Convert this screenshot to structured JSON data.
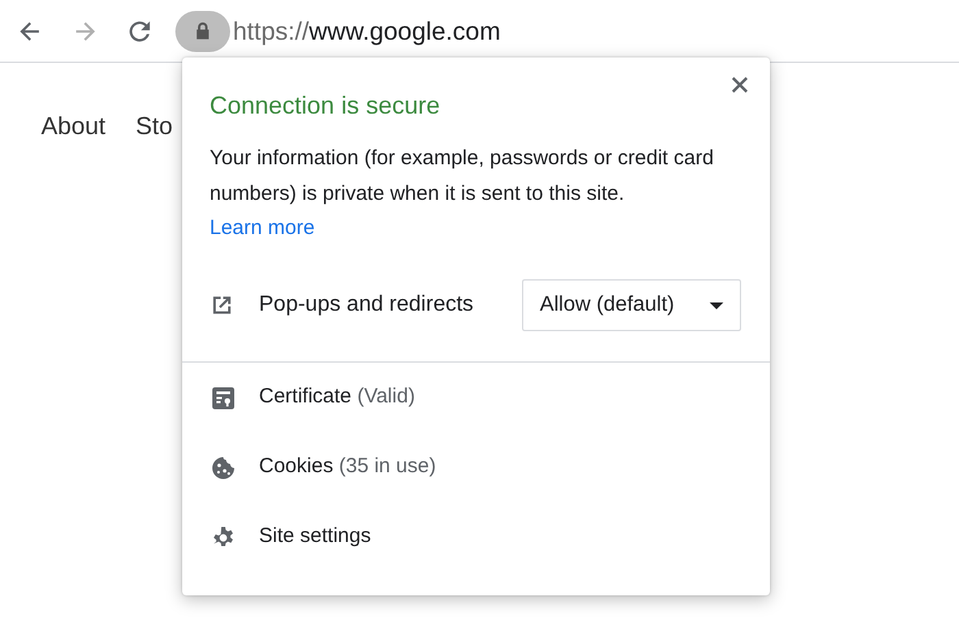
{
  "toolbar": {
    "back": {
      "disabled": false
    },
    "forward": {
      "disabled": true
    },
    "address": {
      "scheme": "https://",
      "host": "www.google.com"
    }
  },
  "page": {
    "links": [
      "About",
      "Sto"
    ]
  },
  "popup": {
    "title": "Connection is secure",
    "description": "Your information (for example, passwords or credit card numbers) is private when it is sent to this site.",
    "learn_more": "Learn more",
    "permission": {
      "label": "Pop-ups and redirects",
      "value": "Allow (default)"
    },
    "items": [
      {
        "kind": "certificate",
        "label": "Certificate",
        "detail": "(Valid)"
      },
      {
        "kind": "cookies",
        "label": "Cookies",
        "detail": "(35 in use)"
      },
      {
        "kind": "settings",
        "label": "Site settings"
      }
    ]
  }
}
